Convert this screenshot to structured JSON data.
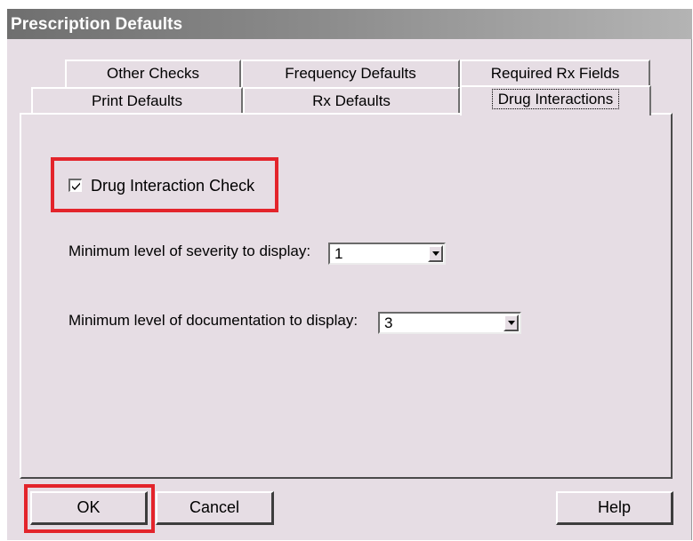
{
  "window": {
    "title": "Prescription Defaults"
  },
  "tabs": {
    "back_row": [
      {
        "label": "Other Checks"
      },
      {
        "label": "Frequency Defaults"
      },
      {
        "label": "Required Rx Fields"
      }
    ],
    "front_row": [
      {
        "label": "Print Defaults"
      },
      {
        "label": "Rx Defaults"
      },
      {
        "label": "Drug Interactions"
      }
    ],
    "active": "Drug Interactions"
  },
  "drug_interactions": {
    "check": {
      "label": "Drug Interaction Check",
      "checked": true
    },
    "severity": {
      "label": "Minimum level of severity to display:",
      "value": "1"
    },
    "documentation": {
      "label": "Minimum level of documentation to display:",
      "value": "3"
    }
  },
  "buttons": {
    "ok": "OK",
    "cancel": "Cancel",
    "help": "Help"
  },
  "colors": {
    "dialog_bg": "#e6dde4",
    "highlight_red": "#e3242b"
  },
  "icons": [
    "checkmark-icon",
    "dropdown-arrow-icon"
  ]
}
